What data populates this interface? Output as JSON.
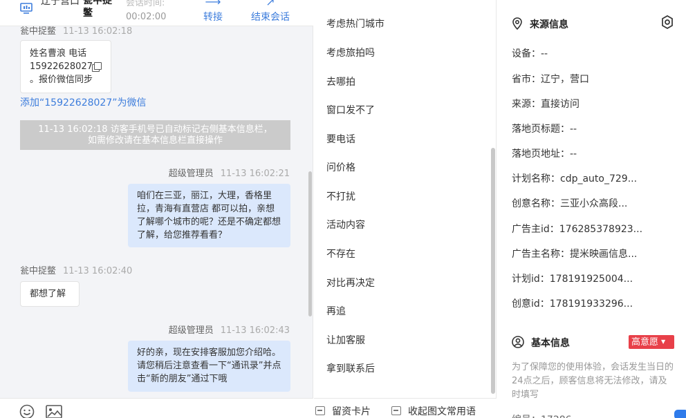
{
  "header": {
    "location": "辽宁营口",
    "visitor_name": "瓮中捉鳖",
    "session_time_label": "会话时间:",
    "session_time": "00:02:00",
    "transfer_label": "转接",
    "end_session_label": "结束会话"
  },
  "chat": {
    "messages": [
      {
        "sender": "瓮中捉鳖",
        "time": "11-13 16:02:18"
      },
      {
        "text_line1": "姓名曹浪  电话",
        "text_line2": "15922628027",
        "text_line3": "。报价微信同步"
      },
      {
        "sender": "超级管理员",
        "time": "11-13 16:02:21",
        "text": "咱们在三亚，丽江，大理，香格里拉，青海有直营店 都可以拍，亲想了解哪个城市的呢？还是不确定都想了解，给您推荐看看？"
      },
      {
        "sender": "瓮中捉鳖",
        "time": "11-13 16:02:40",
        "text": "都想了解"
      },
      {
        "sender": "超级管理员",
        "time": "11-13 16:02:43",
        "text": "好的亲，现在安排客服加您介绍哈。请您稍后注意查看一下“通讯录”并点击“新的朋友”通过下哦"
      }
    ],
    "add_wechat_link": "添加“15922628027”为微信",
    "system_note_line1": "11-13 16:02:18 访客手机号已自动标记右侧基本信息栏，",
    "system_note_line2": "如需修改请在基本信息栏直接操作"
  },
  "phrases": {
    "items": [
      "考虑热门城市",
      "考虑旅拍吗",
      "去哪拍",
      "窗口发不了",
      "要电话",
      "问价格",
      "不打扰",
      "活动内容",
      "不存在",
      "对比再决定",
      "再追",
      "让加客服",
      "拿到联系后"
    ],
    "footer_card": "留资卡片",
    "footer_collapse": "收起图文常用语"
  },
  "source_info": {
    "title": "来源信息",
    "rows": [
      "设备：--",
      "省市：辽宁，营口",
      "来源：直接访问",
      "落地页标题：--",
      "落地页地址：--",
      "计划名称：cdp_auto_729...",
      "创意名称：三亚小众高段...",
      "广告主id：176285378923...",
      "广告主名称：提米映画信息...",
      "计划id：178191925004...",
      "创意id：178191933296..."
    ]
  },
  "basic_info": {
    "title": "基本信息",
    "intent_badge": "高意愿",
    "notice": "为了保障您的使用体验，会话发生当日的24点之后，顾客信息将无法修改，请及时填写",
    "partial_row": "编号：17286"
  },
  "colors": {
    "accent_blue": "#3d7ddc",
    "bubble_blue": "#dbe8fc",
    "badge_red": "#e84049",
    "system_gray": "#cbcbcb"
  },
  "icons": {
    "header": "monitor-icon",
    "transfer": "arrow-right-icon",
    "end_session": "exit-icon",
    "source": "location-pin-icon",
    "basic": "user-circle-icon",
    "settings": "gear-icon",
    "copy": "copy-icon",
    "emoji": "smile-icon",
    "image": "image-icon"
  }
}
